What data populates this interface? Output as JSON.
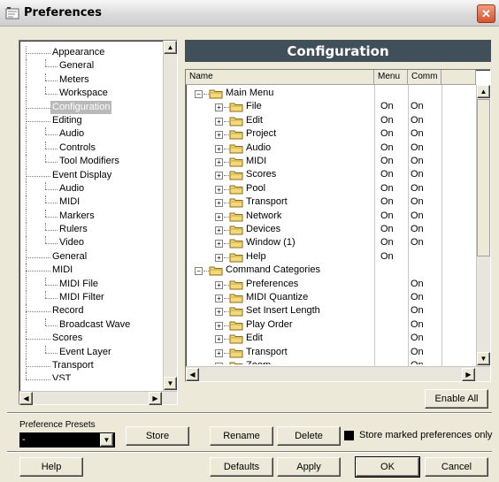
{
  "window": {
    "title": "Preferences",
    "close_icon": "close-icon"
  },
  "tree": {
    "items": [
      {
        "label": "Appearance",
        "level": 0,
        "selected": false
      },
      {
        "label": "General",
        "level": 1,
        "selected": false
      },
      {
        "label": "Meters",
        "level": 1,
        "selected": false
      },
      {
        "label": "Workspace",
        "level": 1,
        "selected": false
      },
      {
        "label": "Configuration",
        "level": 0,
        "selected": true
      },
      {
        "label": "Editing",
        "level": 0,
        "selected": false
      },
      {
        "label": "Audio",
        "level": 1,
        "selected": false
      },
      {
        "label": "Controls",
        "level": 1,
        "selected": false
      },
      {
        "label": "Tool Modifiers",
        "level": 1,
        "selected": false
      },
      {
        "label": "Event Display",
        "level": 0,
        "selected": false
      },
      {
        "label": "Audio",
        "level": 1,
        "selected": false
      },
      {
        "label": "MIDI",
        "level": 1,
        "selected": false
      },
      {
        "label": "Markers",
        "level": 1,
        "selected": false
      },
      {
        "label": "Rulers",
        "level": 1,
        "selected": false
      },
      {
        "label": "Video",
        "level": 1,
        "selected": false
      },
      {
        "label": "General",
        "level": 0,
        "selected": false
      },
      {
        "label": "MIDI",
        "level": 0,
        "selected": false
      },
      {
        "label": "MIDI File",
        "level": 1,
        "selected": false
      },
      {
        "label": "MIDI Filter",
        "level": 1,
        "selected": false
      },
      {
        "label": "Record",
        "level": 0,
        "selected": false
      },
      {
        "label": "Broadcast Wave",
        "level": 1,
        "selected": false
      },
      {
        "label": "Scores",
        "level": 0,
        "selected": false
      },
      {
        "label": "Event Layer",
        "level": 1,
        "selected": false
      },
      {
        "label": "Transport",
        "level": 0,
        "selected": false
      },
      {
        "label": "VST",
        "level": 0,
        "selected": false
      }
    ]
  },
  "config": {
    "title": "Configuration",
    "columns": {
      "name": "Name",
      "menu": "Menu",
      "comm": "Comm"
    },
    "rows": [
      {
        "name": "Main Menu",
        "level": 0,
        "toggle": "−",
        "menu": "",
        "comm": ""
      },
      {
        "name": "File",
        "level": 1,
        "toggle": "+",
        "menu": "On",
        "comm": "On"
      },
      {
        "name": "Edit",
        "level": 1,
        "toggle": "+",
        "menu": "On",
        "comm": "On"
      },
      {
        "name": "Project",
        "level": 1,
        "toggle": "+",
        "menu": "On",
        "comm": "On"
      },
      {
        "name": "Audio",
        "level": 1,
        "toggle": "+",
        "menu": "On",
        "comm": "On"
      },
      {
        "name": "MIDI",
        "level": 1,
        "toggle": "+",
        "menu": "On",
        "comm": "On"
      },
      {
        "name": "Scores",
        "level": 1,
        "toggle": "+",
        "menu": "On",
        "comm": "On"
      },
      {
        "name": "Pool",
        "level": 1,
        "toggle": "+",
        "menu": "On",
        "comm": "On"
      },
      {
        "name": "Transport",
        "level": 1,
        "toggle": "+",
        "menu": "On",
        "comm": "On"
      },
      {
        "name": "Network",
        "level": 1,
        "toggle": "+",
        "menu": "On",
        "comm": "On"
      },
      {
        "name": "Devices",
        "level": 1,
        "toggle": "+",
        "menu": "On",
        "comm": "On"
      },
      {
        "name": "Window (1)",
        "level": 1,
        "toggle": "+",
        "menu": "On",
        "comm": "On"
      },
      {
        "name": "Help",
        "level": 1,
        "toggle": "+",
        "menu": "On",
        "comm": ""
      },
      {
        "name": "Command Categories",
        "level": 0,
        "toggle": "−",
        "menu": "",
        "comm": ""
      },
      {
        "name": "Preferences",
        "level": 1,
        "toggle": "+",
        "menu": "",
        "comm": "On"
      },
      {
        "name": "MIDI Quantize",
        "level": 1,
        "toggle": "+",
        "menu": "",
        "comm": "On"
      },
      {
        "name": "Set Insert Length",
        "level": 1,
        "toggle": "+",
        "menu": "",
        "comm": "On"
      },
      {
        "name": "Play Order",
        "level": 1,
        "toggle": "+",
        "menu": "",
        "comm": "On"
      },
      {
        "name": "Edit",
        "level": 1,
        "toggle": "+",
        "menu": "",
        "comm": "On"
      },
      {
        "name": "Transport",
        "level": 1,
        "toggle": "+",
        "menu": "",
        "comm": "On"
      },
      {
        "name": "Zoom",
        "level": 1,
        "toggle": "+",
        "menu": "",
        "comm": "On"
      }
    ],
    "enable_all_label": "Enable All"
  },
  "presets": {
    "label": "Preference Presets",
    "selected_value": "-",
    "store_label": "Store",
    "rename_label": "Rename",
    "delete_label": "Delete",
    "store_marked_label": "Store marked preferences only"
  },
  "footer": {
    "help_label": "Help",
    "defaults_label": "Defaults",
    "apply_label": "Apply",
    "ok_label": "OK",
    "cancel_label": "Cancel"
  }
}
